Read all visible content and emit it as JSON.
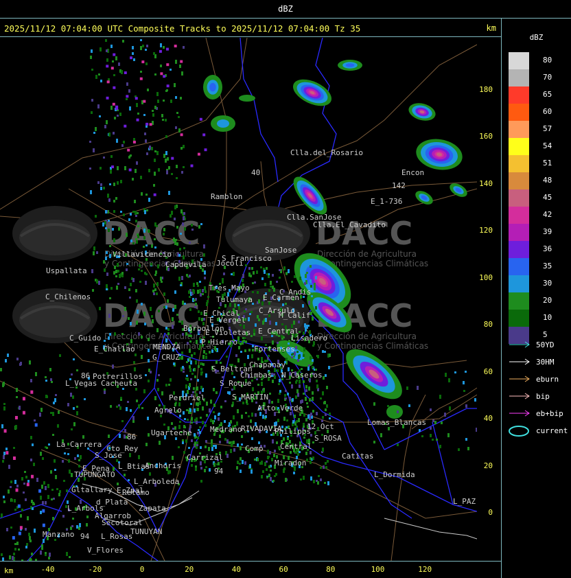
{
  "top_title": "dBZ",
  "header": {
    "text": "2025/11/12 07:04:00 UTC Composite Tracks to 2025/11/12 07:04:00 Tz 35",
    "km_label": "km"
  },
  "legend": {
    "title": "dBZ",
    "scale": [
      {
        "label": "80",
        "color": "#d8d8d8"
      },
      {
        "label": "70",
        "color": "#b4b4b4"
      },
      {
        "label": "65",
        "color": "#ff3a2a"
      },
      {
        "label": "60",
        "color": "#ff5a10"
      },
      {
        "label": "57",
        "color": "#ff9a5a"
      },
      {
        "label": "54",
        "color": "#ffff1a"
      },
      {
        "label": "51",
        "color": "#f4c030"
      },
      {
        "label": "48",
        "color": "#d88a3c"
      },
      {
        "label": "45",
        "color": "#c85f7e"
      },
      {
        "label": "42",
        "color": "#d42d9c"
      },
      {
        "label": "39",
        "color": "#b41eb6"
      },
      {
        "label": "36",
        "color": "#6e1edc"
      },
      {
        "label": "35",
        "color": "#2864f0"
      },
      {
        "label": "30",
        "color": "#1e96dc"
      },
      {
        "label": "20",
        "color": "#1e8c1e"
      },
      {
        "label": "10",
        "color": "#0a6a0a"
      },
      {
        "label": "5",
        "color": "#4a3a8a"
      }
    ],
    "tracks": [
      {
        "label": "50YD",
        "color": "#40e0e0"
      },
      {
        "label": "30HM",
        "color": "#ffffff"
      },
      {
        "label": "eburn",
        "color": "#f0b060"
      },
      {
        "label": "bip",
        "color": "#ffc0c0"
      },
      {
        "label": "eb+bip",
        "color": "#ff40ff"
      }
    ],
    "current_label": "current",
    "current_color": "#40e0e0"
  },
  "axes": {
    "x_unit": "km",
    "x_ticks": [
      "-40",
      "-20",
      "0",
      "20",
      "40",
      "60",
      "80",
      "100",
      "120"
    ],
    "y_ticks": [
      "180",
      "160",
      "140",
      "120",
      "100",
      "80",
      "60",
      "40",
      "20",
      "0"
    ]
  },
  "watermark": {
    "brand": "DACC",
    "subtitle1": "Dirección de Agricultura",
    "subtitle2": "y Contingencias Climáticas"
  },
  "places": [
    "Clla.del_Rosario",
    "Encon",
    "E_1-736",
    "Ramblon",
    "Clla.SanJose",
    "Clla.El_Cavadito",
    "Villavicencio",
    "Uspallata",
    "Capdevila",
    "S_Francisco",
    "SanJose",
    "Jocoli",
    "C_Chilenos",
    "Tres_Mayo",
    "Tulumaya",
    "C_Andis",
    "E_Carmen",
    "E_Chical",
    "E_Vergel",
    "C_Arsulo",
    "M_Calif",
    "Borbollon",
    "E_Violetas",
    "E_Central",
    "Lisadero",
    "P_Hierro",
    "C_Guido",
    "E_Challao",
    "MENDZA",
    "G_CRUZ",
    "Fortenses",
    "Chapanay",
    "S_Beltran",
    "Chimbas",
    "N_Caseros",
    "Potrerillos",
    "L_Vegas",
    "Cacheuta",
    "S_Roque",
    "S_MARTIN",
    "Perdriel",
    "Agrelo",
    "Alto_Verde",
    "Ugarteche",
    "Medrano",
    "RIVADAVIA",
    "Philipps",
    "12_Oct",
    "Lomas_Blancas",
    "S_ROSA",
    "La_Carrera",
    "Cto_Rey",
    "S_Jose",
    "Comp",
    "Central",
    "Catitas",
    "E_Pena",
    "L_Btias",
    "Anchoris",
    "Carrizal",
    "TUPUNGATO",
    "E_Zpal",
    "L_Arboleda",
    "Gltallary",
    "Miradon",
    "L_Dormida",
    "d_Plata",
    "L_Arbols",
    "Zapata",
    "Algarrob",
    "Secotoral",
    "L_PAZ",
    "TUNUYAN",
    "Manzano",
    "L_Rosas",
    "V_Flores",
    "Retamo",
    "142",
    "40",
    "86",
    "86",
    "94",
    "94"
  ]
}
